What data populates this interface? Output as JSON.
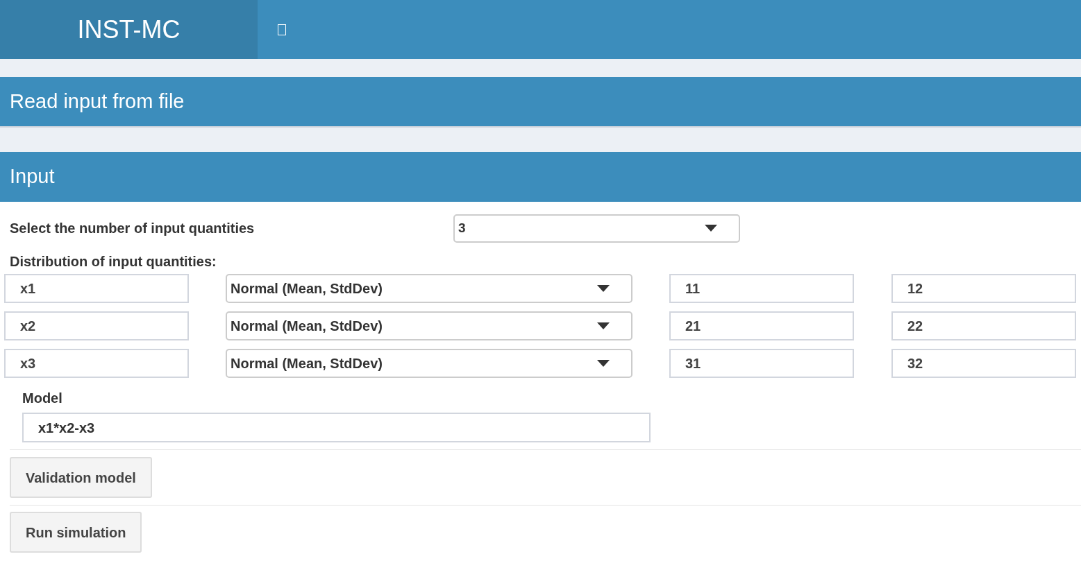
{
  "header": {
    "title": "INST-MC"
  },
  "file_box": {
    "title": "Read input from file"
  },
  "input_box": {
    "title": "Input",
    "quantity_count": {
      "label": "Select the number of input quantities",
      "value": "3"
    },
    "distribution_label": "Distribution of input quantities:",
    "rows": [
      {
        "name": "x1",
        "distribution": "Normal (Mean, StdDev)",
        "param_1": "11",
        "param_2": "12"
      },
      {
        "name": "x2",
        "distribution": "Normal (Mean, StdDev)",
        "param_1": "21",
        "param_2": "22"
      },
      {
        "name": "x3",
        "distribution": "Normal (Mean, StdDev)",
        "param_1": "31",
        "param_2": "32"
      }
    ],
    "model": {
      "label": "Model",
      "value": "x1*x2-x3"
    },
    "buttons": [
      "Validation model",
      "Run simulation"
    ]
  }
}
